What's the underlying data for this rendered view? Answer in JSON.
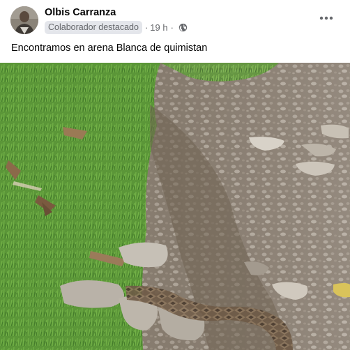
{
  "post": {
    "author_name": "Olbis Carranza",
    "badge": "Colaborador destacado",
    "separator": "·",
    "timestamp": "19 h",
    "privacy_icon": "globe-icon",
    "more_icon": "more-horizontal-icon",
    "caption": "Encontramos en arena Blanca de quimistan"
  },
  "colors": {
    "author_text": "#050505",
    "meta_text": "#65676b",
    "badge_background": "#e4e6eb"
  }
}
